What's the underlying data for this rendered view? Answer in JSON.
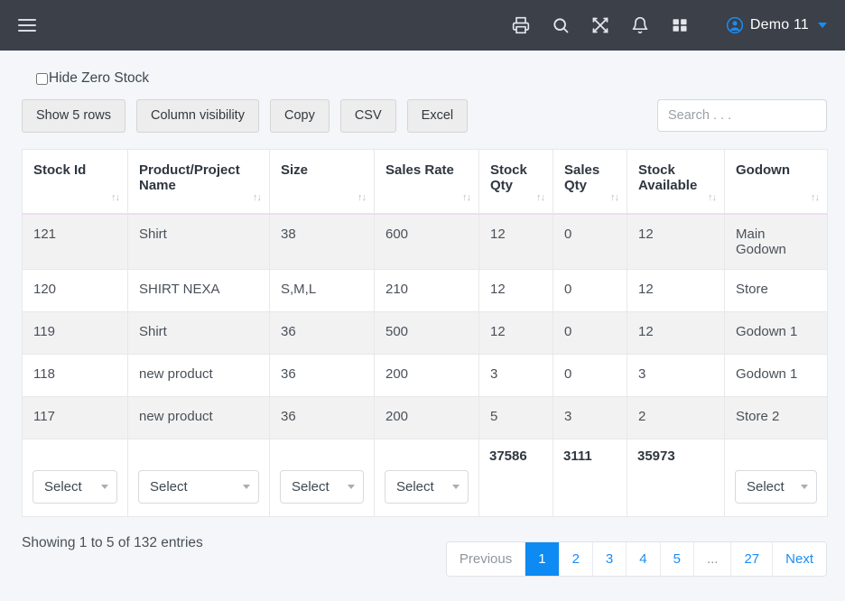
{
  "topbar": {
    "menu_icon": "hamburger-icon",
    "icons": [
      {
        "name": "print-icon",
        "label": "Print"
      },
      {
        "name": "search-icon",
        "label": "Search"
      },
      {
        "name": "fullscreen-icon",
        "label": "Fullscreen"
      },
      {
        "name": "bell-icon",
        "label": "Notifications"
      },
      {
        "name": "apps-grid-icon",
        "label": "Apps"
      }
    ],
    "user_name": "Demo 11",
    "brand_color": "#1b8cf3",
    "bar_color": "#3b4049"
  },
  "filters": {
    "hide_zero_stock_label": "Hide Zero Stock",
    "hide_zero_stock_checked": false
  },
  "toolbar": {
    "buttons": [
      {
        "label": "Show 5 rows",
        "name": "show-rows-button"
      },
      {
        "label": "Column visibility",
        "name": "column-visibility-button"
      },
      {
        "label": "Copy",
        "name": "copy-button"
      },
      {
        "label": "CSV",
        "name": "csv-button"
      },
      {
        "label": "Excel",
        "name": "excel-button"
      }
    ],
    "search_placeholder": "Search . . .",
    "search_value": ""
  },
  "table": {
    "columns": [
      {
        "label": "Stock Id",
        "sortable": true
      },
      {
        "label": "Product/Project Name",
        "sortable": true
      },
      {
        "label": "Size",
        "sortable": true
      },
      {
        "label": "Sales Rate",
        "sortable": true
      },
      {
        "label": "Stock Qty",
        "sortable": true
      },
      {
        "label": "Sales Qty",
        "sortable": true
      },
      {
        "label": "Stock Available",
        "sortable": true
      },
      {
        "label": "Godown",
        "sortable": true
      }
    ],
    "sort_glyph": "↑↓",
    "rows": [
      {
        "stock_id": "121",
        "product": "Shirt",
        "size": "38",
        "sales_rate": "600",
        "stock_qty": "12",
        "sales_qty": "0",
        "stock_available": "12",
        "godown": "Main Godown"
      },
      {
        "stock_id": "120",
        "product": "SHIRT NEXA",
        "size": "S,M,L",
        "sales_rate": "210",
        "stock_qty": "12",
        "sales_qty": "0",
        "stock_available": "12",
        "godown": "Store"
      },
      {
        "stock_id": "119",
        "product": "Shirt",
        "size": "36",
        "sales_rate": "500",
        "stock_qty": "12",
        "sales_qty": "0",
        "stock_available": "12",
        "godown": "Godown 1"
      },
      {
        "stock_id": "118",
        "product": "new product",
        "size": "36",
        "sales_rate": "200",
        "stock_qty": "3",
        "sales_qty": "0",
        "stock_available": "3",
        "godown": "Godown 1"
      },
      {
        "stock_id": "117",
        "product": "new product",
        "size": "36",
        "sales_rate": "200",
        "stock_qty": "5",
        "sales_qty": "3",
        "stock_available": "2",
        "godown": "Store 2"
      }
    ],
    "footer": {
      "select_label": "Select",
      "stock_qty_total": "37586",
      "sales_qty_total": "3111",
      "stock_available_total": "35973"
    }
  },
  "bottom": {
    "showing_info": "Showing 1 to 5 of 132 entries",
    "pagination": [
      {
        "label": "Previous",
        "state": "disabled",
        "name": "page-previous"
      },
      {
        "label": "1",
        "state": "active",
        "name": "page-1"
      },
      {
        "label": "2",
        "state": "normal",
        "name": "page-2"
      },
      {
        "label": "3",
        "state": "normal",
        "name": "page-3"
      },
      {
        "label": "4",
        "state": "normal",
        "name": "page-4"
      },
      {
        "label": "5",
        "state": "normal",
        "name": "page-5"
      },
      {
        "label": "...",
        "state": "ellipsis",
        "name": "page-ellipsis"
      },
      {
        "label": "27",
        "state": "normal",
        "name": "page-27"
      },
      {
        "label": "Next",
        "state": "normal",
        "name": "page-next"
      }
    ]
  }
}
